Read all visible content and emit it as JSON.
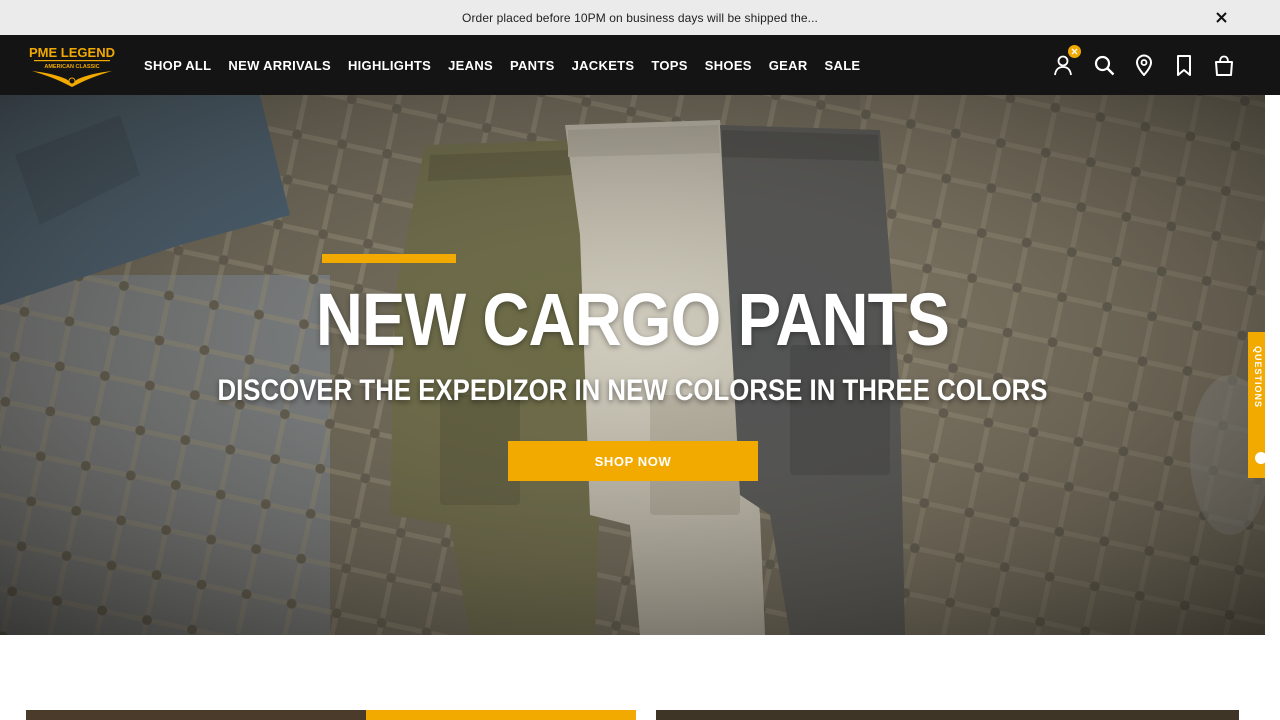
{
  "announcement": {
    "text": "Order placed before 10PM on business days will be shipped the..."
  },
  "brand": {
    "name": "PME LEGEND",
    "tagline": "AMERICAN CLASSIC"
  },
  "nav": {
    "items": [
      {
        "label": "SHOP ALL"
      },
      {
        "label": "NEW ARRIVALS"
      },
      {
        "label": "HIGHLIGHTS"
      },
      {
        "label": "JEANS"
      },
      {
        "label": "PANTS"
      },
      {
        "label": "JACKETS"
      },
      {
        "label": "TOPS"
      },
      {
        "label": "SHOES"
      },
      {
        "label": "GEAR"
      },
      {
        "label": "SALE"
      }
    ]
  },
  "header_icons": [
    "account-icon",
    "search-icon",
    "store-locator-icon",
    "wishlist-icon",
    "cart-icon"
  ],
  "hero": {
    "title": "NEW CARGO PANTS",
    "subtitle": "DISCOVER THE EXPEDIZOR IN NEW COLORSE IN THREE COLORS",
    "cta": "SHOP NOW"
  },
  "side_tab": {
    "label": "QUESTIONS"
  },
  "colors": {
    "accent": "#f2a900",
    "header_bg": "#141414",
    "announce_bg": "#ebebeb"
  }
}
